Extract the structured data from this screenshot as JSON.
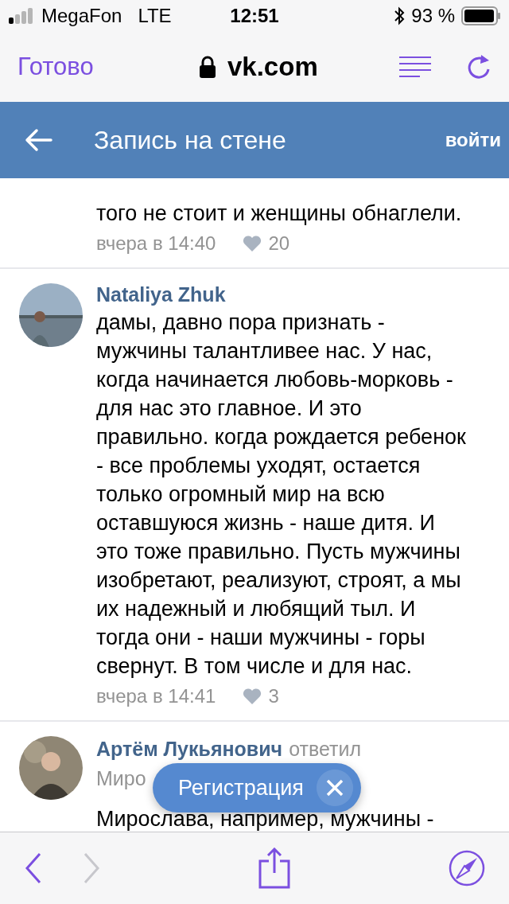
{
  "status_bar": {
    "carrier": "MegaFon",
    "network": "LTE",
    "time": "12:51",
    "battery": "93 %"
  },
  "browser_bar": {
    "done": "Готово",
    "url": "vk.com"
  },
  "header": {
    "title": "Запись на стене",
    "login": "войти"
  },
  "comments": [
    {
      "kind": "tail",
      "text": "того не стоит и женщины обнаглели.",
      "time": "вчера в 14:40",
      "likes": "20"
    },
    {
      "kind": "full",
      "author": "Nataliya Zhuk",
      "text": "дамы, давно пора признать - мужчины талантливее нас. У нас, когда начинается любовь-морковь - для нас это главное. И это правильно. когда рождается ребенок - все проблемы уходят, остается только огромный мир на всю оставшуюся жизнь - наше дитя. И это тоже правильно. Пусть мужчины изобретают, реализуют, строят, а мы их надежный и любящий тыл. И тогда они - наши мужчины - горы свернут. В том числе и для нас.",
      "time": "вчера в 14:41",
      "likes": "3"
    },
    {
      "kind": "reply",
      "author": "Артём Лукьянович",
      "action": "ответил",
      "reply_to": "Миро",
      "text": "Мирослава, например, мужчины -"
    }
  ],
  "popup": {
    "label": "Регистрация"
  },
  "toolbar": [
    {
      "kind": "back",
      "disabled": false
    },
    {
      "kind": "forward",
      "disabled": true
    },
    {
      "kind": "share",
      "disabled": false
    },
    {
      "kind": "compass",
      "disabled": false
    }
  ]
}
